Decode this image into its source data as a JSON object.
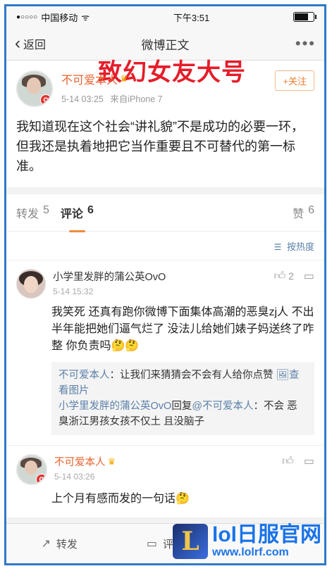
{
  "status": {
    "carrier": "中国移动",
    "signal": "●○○○○",
    "wifi": "ᯤ",
    "time": "下午3:51"
  },
  "nav": {
    "back_label": "返回",
    "title": "微博正文",
    "more": "•••"
  },
  "overlay_caption": "致幻女友大号",
  "post": {
    "author": "不可爱本人",
    "author_badge": "♛",
    "verified_badge": "✪",
    "time": "5-14 03:25",
    "source": "来自iPhone 7",
    "follow_label": "+关注",
    "text": "我知道现在这个社会“讲礼貌”不是成功的必要一环，但我还是执着地把它当作重要且不可替代的第一标准。"
  },
  "tabs": [
    {
      "label": "转发",
      "count": "5"
    },
    {
      "label": "评论",
      "count": "6"
    },
    {
      "label": "赞",
      "count": "6"
    }
  ],
  "sort_label": "按热度",
  "comments": [
    {
      "author": "小学里发胖的蒲公英OvO",
      "time": "5-14 15:32",
      "likes": "2",
      "text": "我笑死 还真有跑你微博下面集体高潮的恶臭zj人 不出半年能把她们逼气烂了 没法儿给她们婊子妈送终了咋整 你负责吗🤔🤔",
      "replies": [
        {
          "name": "不可爱本人",
          "text": "：让我们来猜猜会不会有人给你点赞",
          "link": "🖼查看图片"
        },
        {
          "name": "小学里发胖的蒲公英OvO",
          "mid": "回复",
          "target": "@不可爱本人",
          "text": "：不会 恶臭浙江男孩女孩不仅土 且没脑子"
        }
      ]
    },
    {
      "author": "不可爱本人",
      "author_badge": "♛",
      "time": "5-14 03:26",
      "text": "上个月有感而发的一句话🤔"
    }
  ],
  "bottombar": {
    "repost": "转发",
    "comment": "评论"
  },
  "watermark": {
    "logo": "L",
    "title": "lol日服官网",
    "url": "www.lolrf.com"
  }
}
